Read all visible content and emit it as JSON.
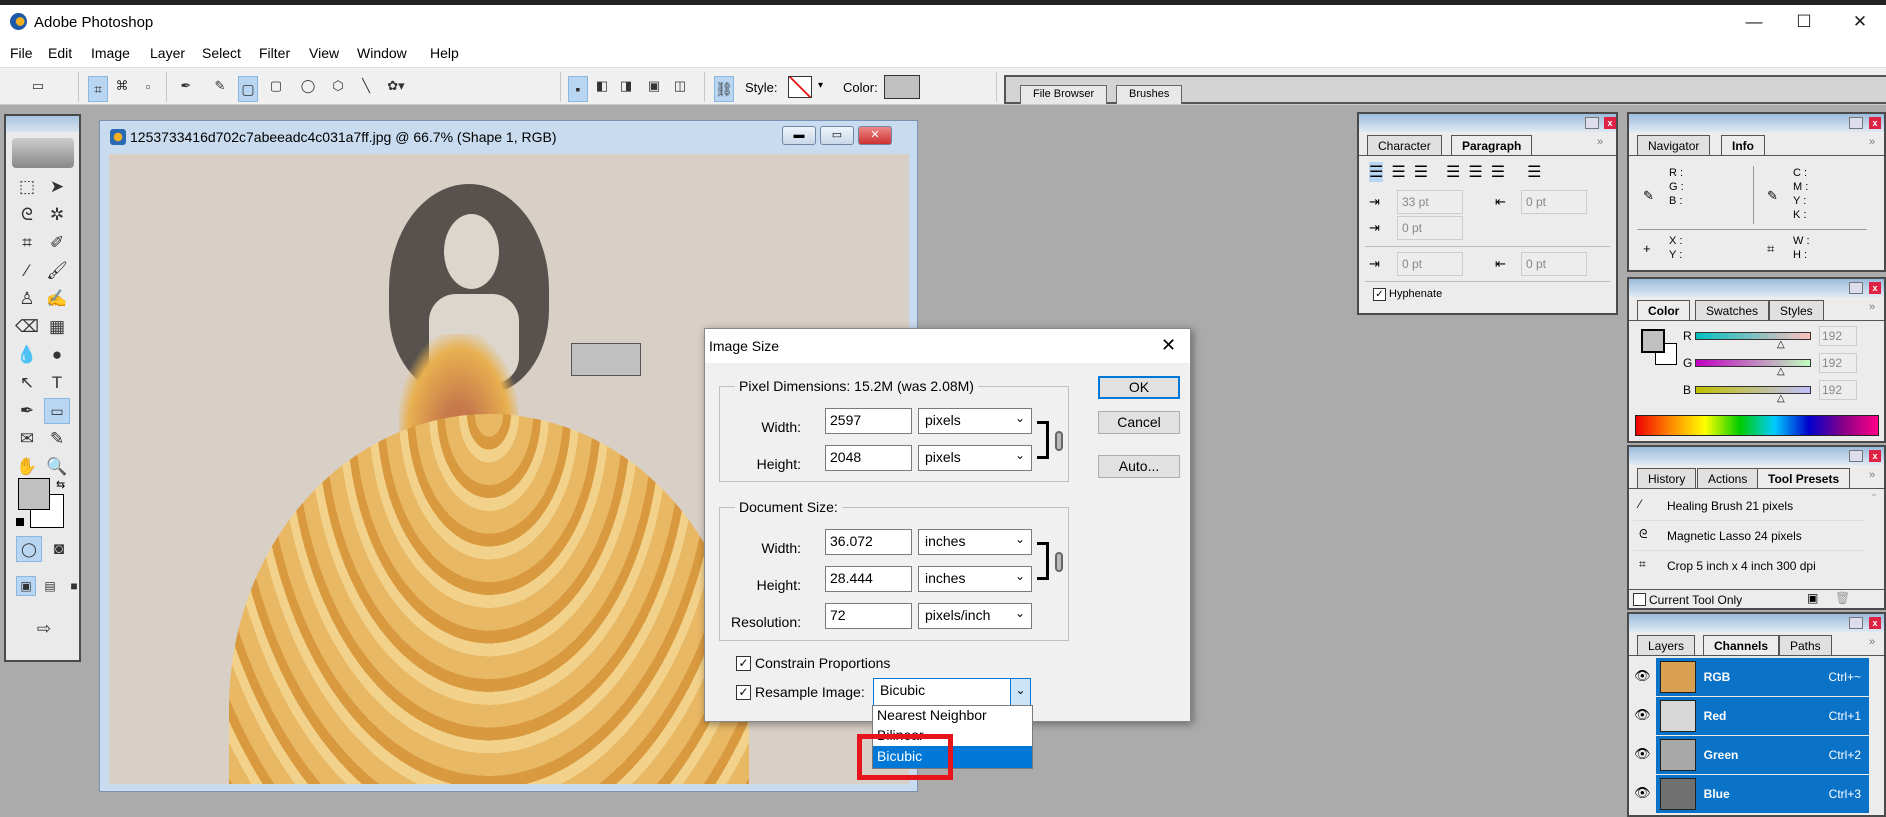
{
  "app": {
    "title": "Adobe Photoshop",
    "window_controls": {
      "minimize": "—",
      "maximize": "☐",
      "close": "✕"
    }
  },
  "menu": [
    "File",
    "Edit",
    "Image",
    "Layer",
    "Select",
    "Filter",
    "View",
    "Window",
    "Help"
  ],
  "options_bar": {
    "style_label": "Style:",
    "color_label": "Color:",
    "color_value": "#c0c0c0"
  },
  "palette_well": {
    "tabs": [
      "File Browser",
      "Brushes"
    ]
  },
  "document": {
    "title": "1253733416d702c7abeeadc4c031a7ff.jpg @ 66.7% (Shape 1, RGB)"
  },
  "dialog": {
    "title": "Image Size",
    "pixel_dimensions": {
      "legend": "Pixel Dimensions:  15.2M (was 2.08M)",
      "width_label": "Width:",
      "width": "2597",
      "width_unit": "pixels",
      "height_label": "Height:",
      "height": "2048",
      "height_unit": "pixels"
    },
    "document_size": {
      "legend": "Document Size:",
      "width_label": "Width:",
      "width": "36.072",
      "width_unit": "inches",
      "height_label": "Height:",
      "height": "28.444",
      "height_unit": "inches",
      "resolution_label": "Resolution:",
      "resolution": "72",
      "resolution_unit": "pixels/inch"
    },
    "buttons": {
      "ok": "OK",
      "cancel": "Cancel",
      "auto": "Auto..."
    },
    "constrain": {
      "label": "Constrain Proportions",
      "checked": true
    },
    "resample": {
      "label": "Resample Image:",
      "checked": true,
      "value": "Bicubic",
      "options": [
        "Nearest Neighbor",
        "Bilinear",
        "Bicubic"
      ],
      "highlighted": "Bicubic"
    },
    "highlight_color": "#e8141c"
  },
  "paragraph_panel": {
    "tabs": [
      "Character",
      "Paragraph"
    ],
    "active": "Paragraph",
    "indent_left": "33 pt",
    "indent_right": "0 pt",
    "indent_first": "0 pt",
    "space_before": "0 pt",
    "space_after": "0 pt",
    "hyphenate_label": "Hyphenate",
    "hyphenate": true
  },
  "info_panel": {
    "tabs": [
      "Navigator",
      "Info"
    ],
    "active": "Info",
    "rgb": [
      "R :",
      "G :",
      "B :"
    ],
    "cmyk": [
      "C :",
      "M :",
      "Y :",
      "K :"
    ],
    "xy": [
      "X :",
      "Y :"
    ],
    "wh": [
      "W :",
      "H :"
    ]
  },
  "color_panel": {
    "tabs": [
      "Color",
      "Swatches",
      "Styles"
    ],
    "active": "Color",
    "channels": [
      {
        "label": "R",
        "value": "192"
      },
      {
        "label": "G",
        "value": "192"
      },
      {
        "label": "B",
        "value": "192"
      }
    ],
    "foreground": "#c0c0c0"
  },
  "tool_presets_panel": {
    "tabs": [
      "History",
      "Actions",
      "Tool Presets"
    ],
    "active": "Tool Presets",
    "items": [
      "Healing Brush 21 pixels",
      "Magnetic Lasso 24 pixels",
      "Crop 5 inch x 4 inch 300 dpi"
    ],
    "current_tool_only": "Current Tool Only"
  },
  "channels_panel": {
    "tabs": [
      "Layers",
      "Channels",
      "Paths"
    ],
    "active": "Channels",
    "channels": [
      {
        "name": "RGB",
        "shortcut": "Ctrl+~"
      },
      {
        "name": "Red",
        "shortcut": "Ctrl+1"
      },
      {
        "name": "Green",
        "shortcut": "Ctrl+2"
      },
      {
        "name": "Blue",
        "shortcut": "Ctrl+3"
      }
    ],
    "selection_color": "#0a73c8"
  }
}
